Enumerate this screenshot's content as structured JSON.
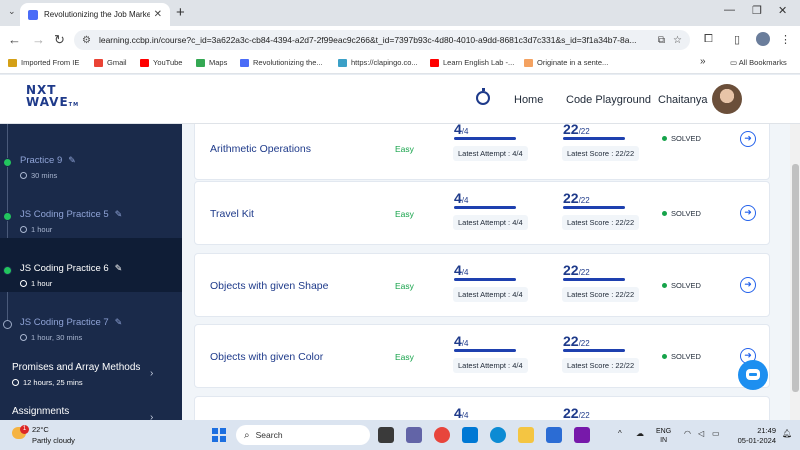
{
  "browser": {
    "tab_title": "Revolutionizing the Job Market",
    "tab_close": "✕",
    "new_tab": "+",
    "url": "learning.ccbp.in/course?c_id=3a622a3c-cb84-4394-a2d7-2f99eac9c266&t_id=7397b93c-4d80-4010-a9dd-8681c3d7c331&s_id=3f1a34b7-8a..."
  },
  "bookmarks": [
    {
      "label": "Imported From IE",
      "color": "#d4a017"
    },
    {
      "label": "Gmail",
      "color": "#ea4335"
    },
    {
      "label": "YouTube",
      "color": "#ff0000"
    },
    {
      "label": "Maps",
      "color": "#34a853"
    },
    {
      "label": "Revolutionizing the...",
      "color": "#4a6cf7"
    },
    {
      "label": "https://clapingo.co...",
      "color": "#3ba0c7"
    },
    {
      "label": "Learn English Lab -...",
      "color": "#ff0000"
    },
    {
      "label": "Originate in a sente...",
      "color": "#f4a261"
    }
  ],
  "bookmarks_all": "All Bookmarks",
  "header": {
    "logo_line1": "NXT",
    "logo_line2": "WAVE",
    "logo_tm": "TM",
    "nav": [
      "Home",
      "Code Playground"
    ],
    "user_name": "Chaitanya"
  },
  "sidebar": {
    "items": [
      {
        "title": "Practice 9",
        "duration": "30 mins",
        "state": "done"
      },
      {
        "title": "JS Coding Practice 5",
        "duration": "1 hour",
        "state": "done"
      },
      {
        "title": "JS Coding Practice 6",
        "duration": "1 hour",
        "state": "active"
      },
      {
        "title": "JS Coding Practice 7",
        "duration": "1 hour, 30 mins",
        "state": "open"
      }
    ],
    "sections": [
      {
        "title": "Promises and Array Methods",
        "duration": "12 hours, 25 mins"
      },
      {
        "title": "Assignments",
        "duration": ""
      }
    ]
  },
  "problems": [
    {
      "name": "Arithmetic Operations",
      "difficulty": "Easy",
      "attempt": "4",
      "attempt_total": "/4",
      "attempt_label": "Latest Attempt : 4/4",
      "score": "22",
      "score_total": "/22",
      "score_label": "Latest Score : 22/22",
      "status": "SOLVED"
    },
    {
      "name": "Travel Kit",
      "difficulty": "Easy",
      "attempt": "4",
      "attempt_total": "/4",
      "attempt_label": "Latest Attempt : 4/4",
      "score": "22",
      "score_total": "/22",
      "score_label": "Latest Score : 22/22",
      "status": "SOLVED"
    },
    {
      "name": "Objects with given Shape",
      "difficulty": "Easy",
      "attempt": "4",
      "attempt_total": "/4",
      "attempt_label": "Latest Attempt : 4/4",
      "score": "22",
      "score_total": "/22",
      "score_label": "Latest Score : 22/22",
      "status": "SOLVED"
    },
    {
      "name": "Objects with given Color",
      "difficulty": "Easy",
      "attempt": "4",
      "attempt_total": "/4",
      "attempt_label": "Latest Attempt : 4/4",
      "score": "22",
      "score_total": "/22",
      "score_label": "Latest Score : 22/22",
      "status": "SOLVED"
    },
    {
      "name": "",
      "difficulty": "",
      "attempt": "4",
      "attempt_total": "/4",
      "attempt_label": "",
      "score": "22",
      "score_total": "/22",
      "score_label": "",
      "status": ""
    }
  ],
  "taskbar": {
    "temp": "22°C",
    "weather": "Partly cloudy",
    "badge": "1",
    "search_placeholder": "Search",
    "lang1": "ENG",
    "lang2": "IN",
    "time": "21:49",
    "date": "05-01-2024"
  }
}
